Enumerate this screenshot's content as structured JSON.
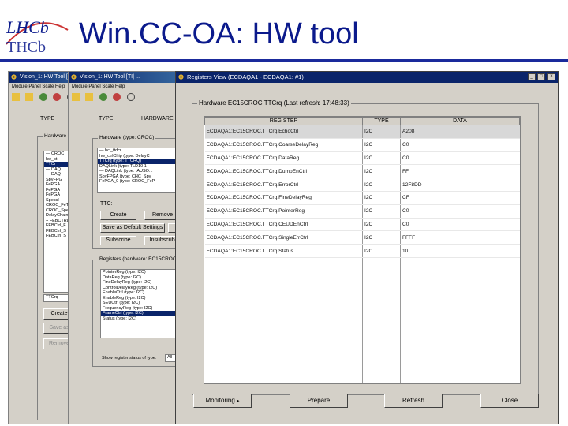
{
  "slide": {
    "title": "Win.CC-OA: HW tool",
    "logo_text_top": "LHCb",
    "logo_text_bottom": "THCb"
  },
  "colors": {
    "title": "#0b1a8c",
    "rule": "#1a2a9c",
    "titlebar": "#0a246a",
    "window_bg": "#d4d0c8"
  },
  "back_window_1": {
    "title": "Vision_1: HW Tool [TI",
    "menu": "Module  Panel  Scale  Help",
    "tab_type": "TYPE",
    "group_label": "Hardware ty",
    "tree": [
      "— CROC_",
      "   hw_ct",
      "   TTCr",
      "   — DAQ",
      "   — DAQ",
      "   SpyFPG",
      "   FePGA",
      "   FePGA",
      "   FePGA",
      "   SpecsI",
      "CROC_FeTU",
      "CROC_SpeS",
      "DelayChain",
      "+ FEBCTRL_",
      "FEBCtrl_F",
      "FEBCtrl_S",
      "FEBCtrl_S"
    ],
    "field_value": "TTCrq",
    "buttons": [
      "Create",
      "Save as",
      "Remove"
    ]
  },
  "back_window_2": {
    "title": "Vision_1: HW Tool [TI] ...",
    "menu": "Module  Panel  Scale  Help",
    "tab_type": "TYPE",
    "tab_hardware": "HARDWARE",
    "group_label": "Hardware (type: CROC)",
    "tree": [
      "— hcl_ttdcr...",
      "   hw_ctrlChip (type: DelayC",
      "   TTCrq (type: TTCRQ)",
      "   DAQLink (type: TLD10 1",
      "   — DAQLink (type: IAUSO...",
      "   SpyFPGA (type: CHC_Spy",
      "   FePGA_0 (type: CROC_FeP"
    ],
    "ttc_label": "TTC:",
    "buttons": [
      "Create",
      "Remove",
      "Save as Default Settings",
      "Ap",
      "Subscribe",
      "Unsubscribe"
    ],
    "reg_group_label": "Registers (hardware: EC15CROC",
    "reg_list": [
      "PointerReg (type: I2C)",
      "DataReg (type: I2C)",
      "FineDelayReg (type: I2C)",
      "ControlDelayReg (type: I2C)",
      "EnableCtrl (type: I2C)",
      "EnableReg (type: I2C)",
      "SEUCtrl (type: I2C)",
      "FrequencyReg (type: I2C)",
      "FrameCtrl (type: I2C)",
      "Status (type: I2C)"
    ],
    "reg_list_selected_index": 8,
    "status_label": "Show register status of type:",
    "status_value": "All"
  },
  "registers_view": {
    "window_title": "Registers View (ECDAQA1 - ECDAQA1: #1)",
    "controls": [
      "_",
      "□",
      "×"
    ],
    "group_label": "Hardware EC15CROC.TTCrq (Last refresh: 17:48:33)",
    "columns": [
      "REG STEP",
      "TYPE",
      "DATA"
    ],
    "rows": [
      {
        "reg": "ECDAQA1:EC15CROC.TTCrq.EchoCtrl",
        "type": "I2C",
        "data": "A208"
      },
      {
        "reg": "ECDAQA1:EC15CROC.TTCrq.CoarseDelayReg",
        "type": "I2C",
        "data": "C0"
      },
      {
        "reg": "ECDAQA1:EC15CROC.TTCrq.DataReg",
        "type": "I2C",
        "data": "C0"
      },
      {
        "reg": "ECDAQA1:EC15CROC.TTCrq.DumpEnCtrl",
        "type": "I2C",
        "data": "FF"
      },
      {
        "reg": "ECDAQA1:EC15CROC.TTCrq.ErrorCtrl",
        "type": "I2C",
        "data": "12F8DD"
      },
      {
        "reg": "ECDAQA1:EC15CROC.TTCrq.FineDelayReg",
        "type": "I2C",
        "data": "CF"
      },
      {
        "reg": "ECDAQA1:EC15CROC.TTCrq.PointerReg",
        "type": "I2C",
        "data": "C0"
      },
      {
        "reg": "ECDAQA1:EC15CROC.TTCrq.CEUDEnCtrl",
        "type": "I2C",
        "data": "C0"
      },
      {
        "reg": "ECDAQA1:EC15CROC.TTCrq.SingleErrCtrl",
        "type": "I2C",
        "data": "FFFF"
      },
      {
        "reg": "ECDAQA1:EC15CROC.TTCrq.Status",
        "type": "I2C",
        "data": "10"
      }
    ],
    "selected_row": 0,
    "buttons": {
      "monitoring": "Monitoring",
      "monitoring_arrow": "▸",
      "prepare": "Prepare",
      "refresh": "Refresh",
      "close": "Close"
    }
  }
}
